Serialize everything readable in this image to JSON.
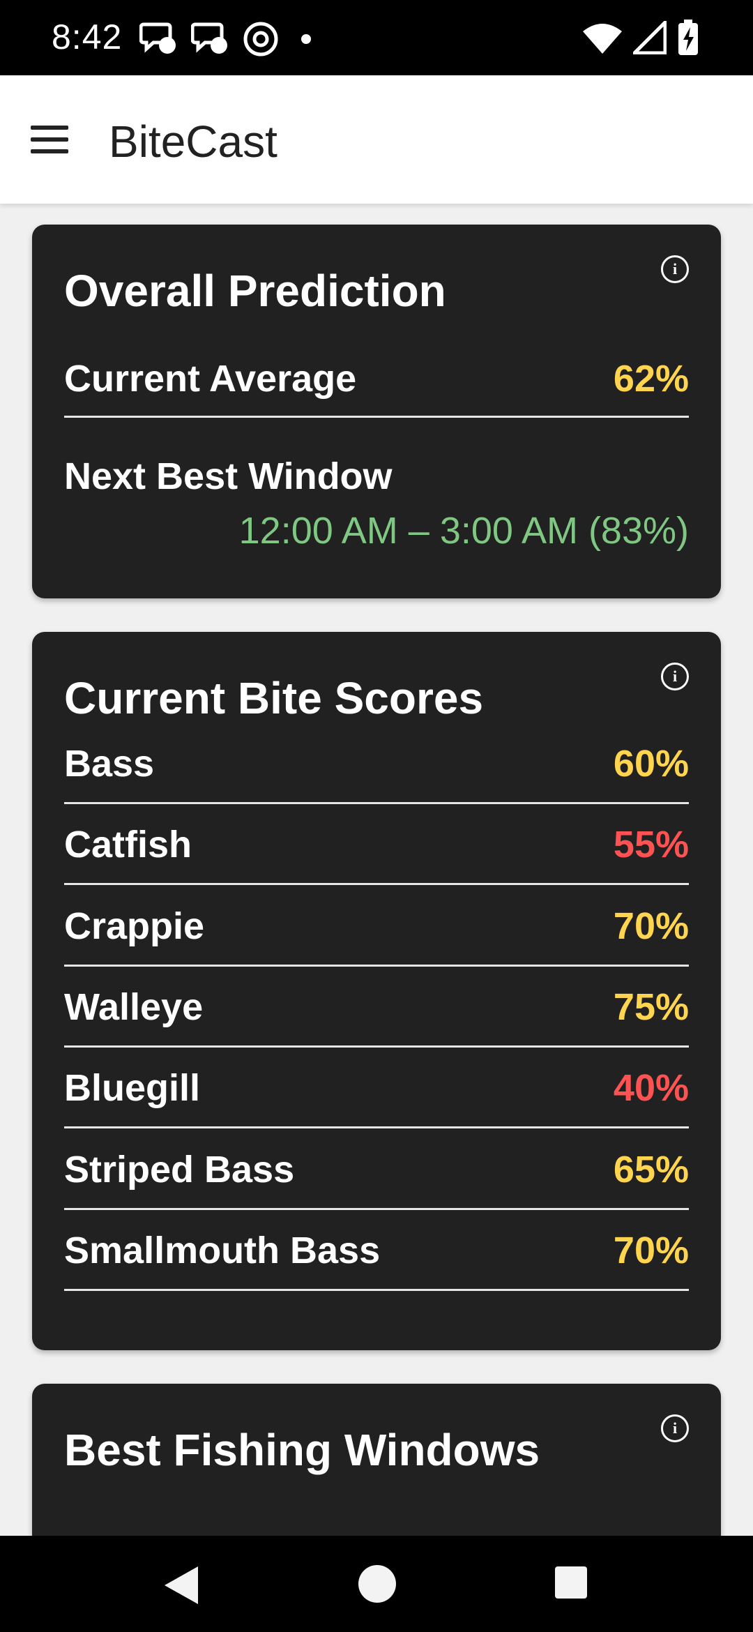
{
  "status_bar": {
    "time": "8:42"
  },
  "app_bar": {
    "title": "BiteCast"
  },
  "colors": {
    "good": "#ffd54f",
    "bad": "#ff5252",
    "window": "#81c784",
    "card_bg": "#212121"
  },
  "overall": {
    "title": "Overall Prediction",
    "current_average_label": "Current Average",
    "current_average_value": "62%",
    "next_window_label": "Next Best Window",
    "next_window_value": "12:00 AM – 3:00 AM (83%)"
  },
  "scores": {
    "title": "Current Bite Scores",
    "items": [
      {
        "label": "Bass",
        "value": "60%",
        "status": "good"
      },
      {
        "label": "Catfish",
        "value": "55%",
        "status": "bad"
      },
      {
        "label": "Crappie",
        "value": "70%",
        "status": "good"
      },
      {
        "label": "Walleye",
        "value": "75%",
        "status": "good"
      },
      {
        "label": "Bluegill",
        "value": "40%",
        "status": "bad"
      },
      {
        "label": "Striped Bass",
        "value": "65%",
        "status": "good"
      },
      {
        "label": "Smallmouth Bass",
        "value": "70%",
        "status": "good"
      }
    ]
  },
  "windows": {
    "title": "Best Fishing Windows"
  },
  "icons": {
    "menu": "menu-icon",
    "info": "info-icon"
  }
}
